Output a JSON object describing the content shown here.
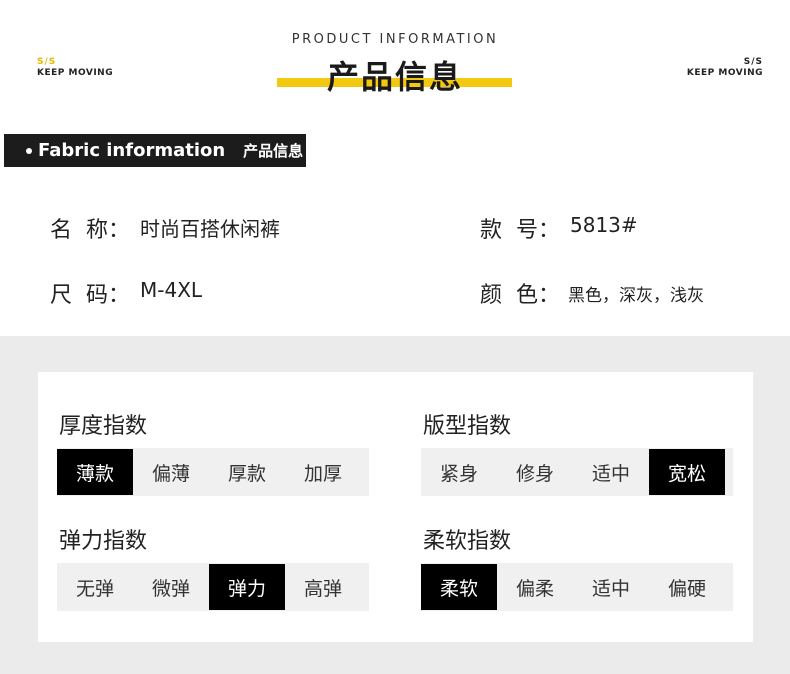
{
  "header": {
    "brand_left_ss": "S/S",
    "brand_left_text": "KEEP MOVING",
    "brand_right_ss": "S/S",
    "brand_right_text": "KEEP MOVING",
    "subtitle": "PRODUCT INFORMATION",
    "title": "产品信息",
    "accent_color": "#f2c811"
  },
  "banner": {
    "en": "Fabric information",
    "cn": "产品信息"
  },
  "info": {
    "name_label": "名  称：",
    "name_value": "时尚百搭休闲裤",
    "style_label": "款  号：",
    "style_value": "5813#",
    "size_label": "尺  码：",
    "size_value": "M-4XL",
    "color_label": "颜  色：",
    "color_value": "黑色，深灰，浅灰"
  },
  "indices": {
    "thickness": {
      "title": "厚度指数",
      "options": [
        "薄款",
        "偏薄",
        "厚款",
        "加厚"
      ],
      "selected": "薄款"
    },
    "fit": {
      "title": "版型指数",
      "options": [
        "紧身",
        "修身",
        "适中",
        "宽松"
      ],
      "selected": "宽松"
    },
    "elasticity": {
      "title": "弹力指数",
      "options": [
        "无弹",
        "微弹",
        "弹力",
        "高弹"
      ],
      "selected": "弹力"
    },
    "softness": {
      "title": "柔软指数",
      "options": [
        "柔软",
        "偏柔",
        "适中",
        "偏硬"
      ],
      "selected": "柔软"
    }
  }
}
